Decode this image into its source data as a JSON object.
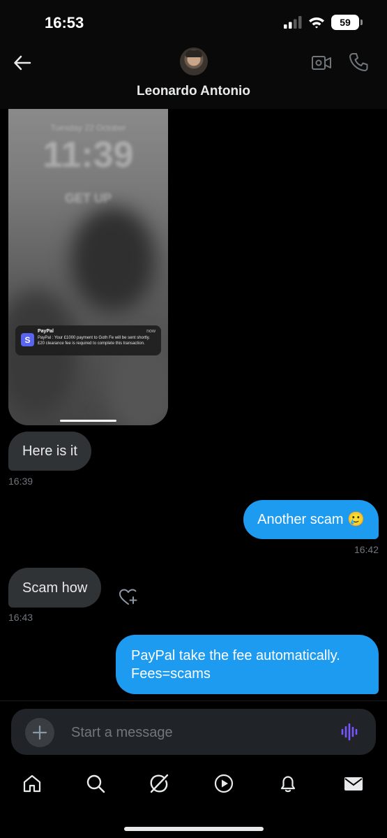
{
  "status_bar": {
    "time": "16:53",
    "battery": "59"
  },
  "header": {
    "contact_name": "Leonardo Antonio"
  },
  "media": {
    "lockscreen_date": "Tuesday 22 October",
    "lockscreen_time": "11:39",
    "lockscreen_caption": "GET UP",
    "notification": {
      "app": "PayPal",
      "time": "now",
      "icon_letter": "S",
      "body": "PayPal : Your £1000 payment to Goth Fe will be sent shortly.£20 clearance fee is required to complete this transaction."
    }
  },
  "messages": [
    {
      "direction": "incoming",
      "text": "Here is it",
      "time": "16:39"
    },
    {
      "direction": "outgoing",
      "text": "Another scam 🥲",
      "time": "16:42"
    },
    {
      "direction": "incoming",
      "text": "Scam how",
      "time": "16:43"
    },
    {
      "direction": "outgoing",
      "text": "PayPal take the fee automatically. Fees=scams",
      "time": ""
    }
  ],
  "composer": {
    "placeholder": "Start a message"
  },
  "icons": {
    "back": "arrow-left-icon",
    "video": "video-call-icon",
    "call": "phone-icon",
    "react": "heart-add-icon",
    "add": "plus-icon",
    "voice": "voice-waveform-icon",
    "tabs": [
      "home-icon",
      "search-icon",
      "grok-icon",
      "video-play-icon",
      "bell-icon",
      "mail-icon"
    ]
  },
  "colors": {
    "outgoing_bubble": "#1d9bf0",
    "incoming_bubble": "#2f3336",
    "background": "#000000",
    "voice_accent": "#7856ff"
  }
}
